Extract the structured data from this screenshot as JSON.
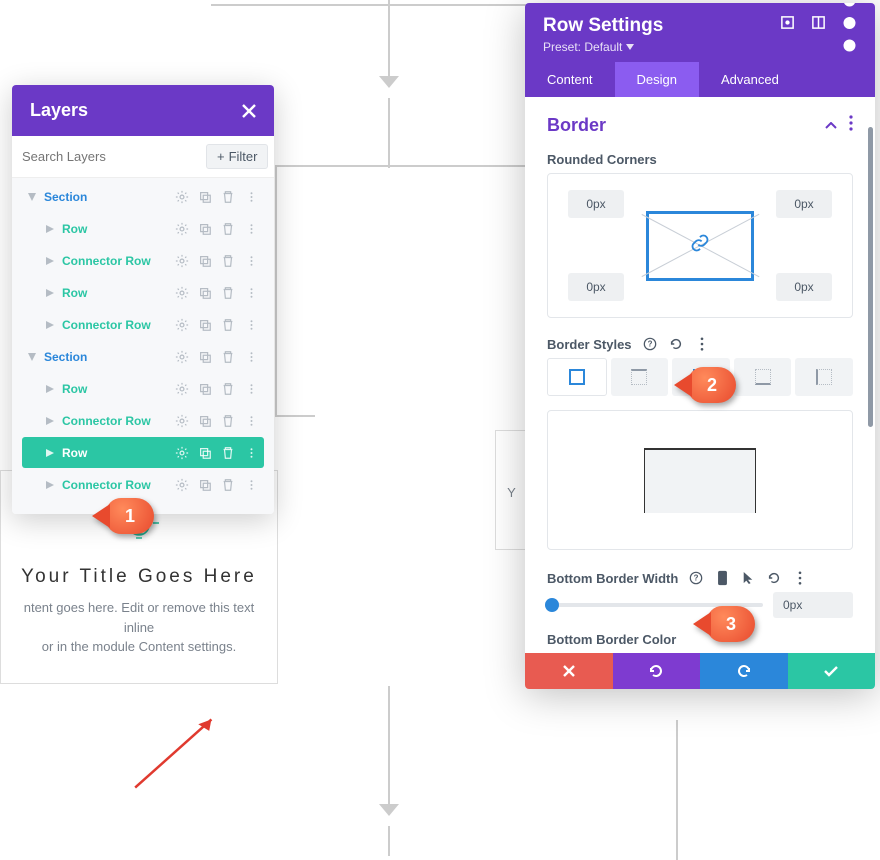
{
  "layers": {
    "title": "Layers",
    "search_placeholder": "Search Layers",
    "filter_label": "Filter",
    "items": [
      {
        "label": "Section",
        "type": "section"
      },
      {
        "label": "Row",
        "type": "child"
      },
      {
        "label": "Connector Row",
        "type": "child"
      },
      {
        "label": "Row",
        "type": "child"
      },
      {
        "label": "Connector Row",
        "type": "child"
      },
      {
        "label": "Section",
        "type": "section"
      },
      {
        "label": "Row",
        "type": "child"
      },
      {
        "label": "Connector Row",
        "type": "child"
      },
      {
        "label": "Row",
        "type": "child",
        "selected": true
      },
      {
        "label": "Connector Row",
        "type": "child"
      }
    ]
  },
  "settings": {
    "title": "Row Settings",
    "preset_label": "Preset: Default ",
    "tabs": {
      "content": "Content",
      "design": "Design",
      "advanced": "Advanced"
    },
    "border_section_title": "Border",
    "rounded_label": "Rounded Corners",
    "corner_values": {
      "tl": "0px",
      "tr": "0px",
      "bl": "0px",
      "br": "0px"
    },
    "styles_label": "Border Styles",
    "bbw_label": "Bottom Border Width",
    "bbw_value": "0px",
    "bbc_label": "Bottom Border Color"
  },
  "card": {
    "title": "Your Title Goes Here",
    "text_line1": "ntent goes here. Edit or remove this text inline",
    "text_line2": "or in the module Content settings."
  },
  "card2": {
    "text": "Y"
  },
  "markers": {
    "m1": "1",
    "m2": "2",
    "m3": "3"
  }
}
